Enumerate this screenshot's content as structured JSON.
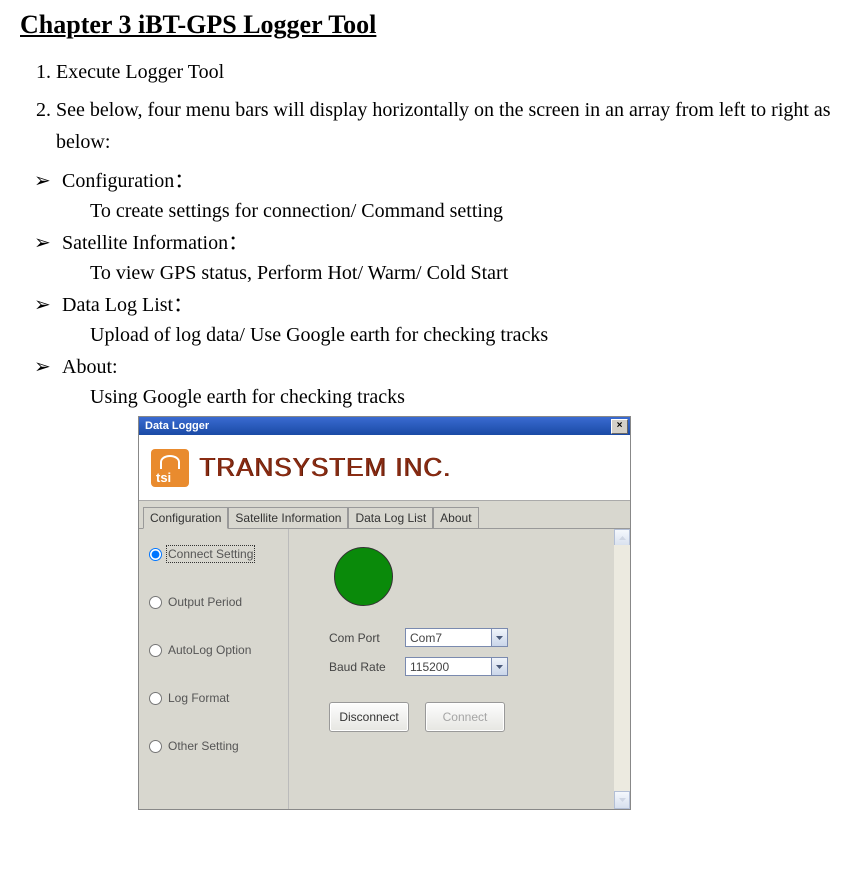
{
  "heading": "Chapter 3 iBT-GPS Logger Tool",
  "steps": {
    "s1": "Execute Logger Tool",
    "s2": "See below, four menu bars will display horizontally on the screen in an array from left to right as below:"
  },
  "bullets": {
    "b1_title": "Configuration：",
    "b1_desc": "To create settings for connection/ Command setting",
    "b2_title": "Satellite Information：",
    "b2_desc": "To view GPS status, Perform Hot/ Warm/ Cold Start",
    "b3_title": "Data Log List：",
    "b3_desc": "Upload of log data/ Use Google earth for checking tracks",
    "b4_title": "About:",
    "b4_desc": "Using Google earth for checking tracks"
  },
  "app": {
    "window_title": "Data Logger",
    "close": "×",
    "logo_text": "TRANSYSTEM INC.",
    "tabs": {
      "t1": "Configuration",
      "t2": "Satellite Information",
      "t3": "Data Log List",
      "t4": "About"
    },
    "sidebar": {
      "r1": "Connect Setting",
      "r2": "Output Period",
      "r3": "AutoLog Option",
      "r4": "Log Format",
      "r5": "Other Setting"
    },
    "form": {
      "com_label": "Com Port",
      "com_value": "Com7",
      "baud_label": "Baud Rate",
      "baud_value": "115200"
    },
    "buttons": {
      "disconnect": "Disconnect",
      "connect": "Connect"
    }
  }
}
